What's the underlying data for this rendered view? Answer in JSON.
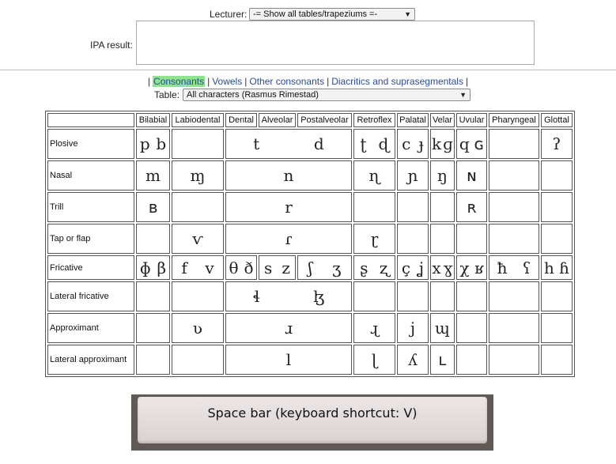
{
  "lecturer": {
    "label": "Lecturer:",
    "selected": "-= Show all tables/trapeziums =-"
  },
  "ipa_result": {
    "label": "IPA result:",
    "value": ""
  },
  "nav": {
    "tabs": [
      {
        "label": "Consonants",
        "active": true
      },
      {
        "label": "Vowels",
        "active": false
      },
      {
        "label": "Other consonants",
        "active": false
      },
      {
        "label": "Diacritics and suprasegmentals",
        "active": false
      }
    ]
  },
  "table_select": {
    "label": "Table:",
    "selected": "All characters (Rasmus Rimestad)"
  },
  "columns": [
    "Bilabial",
    "Labiodental",
    "Dental",
    "Alveolar",
    "Postalveolar",
    "Retroflex",
    "Palatal",
    "Velar",
    "Uvular",
    "Pharyngeal",
    "Glottal"
  ],
  "rows": [
    {
      "label": "Plosive",
      "bilabial": [
        "p",
        "b"
      ],
      "labiodental": [],
      "dent_post": [
        "t",
        "d"
      ],
      "retroflex": [
        "ʈ",
        "ɖ"
      ],
      "palatal": [
        "c",
        "ɟ"
      ],
      "velar": [
        "k",
        "ɡ"
      ],
      "uvular": [
        "q",
        "ɢ"
      ],
      "pharyngeal": [],
      "glottal": [
        "ʔ"
      ]
    },
    {
      "label": "Nasal",
      "bilabial": [
        "m"
      ],
      "labiodental": [
        "ɱ"
      ],
      "dent_post": [
        "n"
      ],
      "retroflex": [
        "ɳ"
      ],
      "palatal": [
        "ɲ"
      ],
      "velar": [
        "ŋ"
      ],
      "uvular": [
        "ɴ"
      ],
      "pharyngeal": [],
      "glottal": []
    },
    {
      "label": "Trill",
      "bilabial": [
        "ʙ"
      ],
      "labiodental": [],
      "dent_post": [
        "r"
      ],
      "retroflex": [],
      "palatal": [],
      "velar": [],
      "uvular": [
        "ʀ"
      ],
      "pharyngeal": [],
      "glottal": []
    },
    {
      "label": "Tap or flap",
      "bilabial": [],
      "labiodental": [
        "ⱱ"
      ],
      "dent_post": [
        "ɾ"
      ],
      "retroflex": [
        "ɽ"
      ],
      "palatal": [],
      "velar": [],
      "uvular": [],
      "pharyngeal": [],
      "glottal": []
    },
    {
      "label": "Fricative",
      "bilabial": [
        "ɸ",
        "β"
      ],
      "labiodental": [
        "f",
        "v"
      ],
      "dental": [
        "θ",
        "ð"
      ],
      "alveolar": [
        "s",
        "z"
      ],
      "postalveolar": [
        "ʃ",
        "ʒ"
      ],
      "retroflex": [
        "ʂ",
        "ʐ"
      ],
      "palatal": [
        "ç",
        "ʝ"
      ],
      "velar": [
        "x",
        "ɣ"
      ],
      "uvular": [
        "χ",
        "ʁ"
      ],
      "pharyngeal": [
        "ħ",
        "ʕ"
      ],
      "glottal": [
        "h",
        "ɦ"
      ]
    },
    {
      "label": "Lateral fricative",
      "bilabial": [],
      "labiodental": [],
      "dent_post": [
        "ɬ",
        "ɮ"
      ],
      "retroflex": [],
      "palatal": [],
      "velar": [],
      "uvular": [],
      "pharyngeal": [],
      "glottal": []
    },
    {
      "label": "Approximant",
      "bilabial": [],
      "labiodental": [
        "ʋ"
      ],
      "dent_post": [
        "ɹ"
      ],
      "retroflex": [
        "ɻ"
      ],
      "palatal": [
        "j"
      ],
      "velar": [
        "ɰ"
      ],
      "uvular": [],
      "pharyngeal": [],
      "glottal": []
    },
    {
      "label": "Lateral approximant",
      "bilabial": [],
      "labiodental": [],
      "dent_post": [
        "l"
      ],
      "retroflex": [
        "ɭ"
      ],
      "palatal": [
        "ʎ"
      ],
      "velar": [
        "ʟ"
      ],
      "uvular": [],
      "pharyngeal": [],
      "glottal": []
    }
  ],
  "spacebar": {
    "label": "Space bar (keyboard shortcut: V)"
  },
  "colors": {
    "active_tab_bg": "#8fe38c",
    "link": "#2a4b9b"
  }
}
